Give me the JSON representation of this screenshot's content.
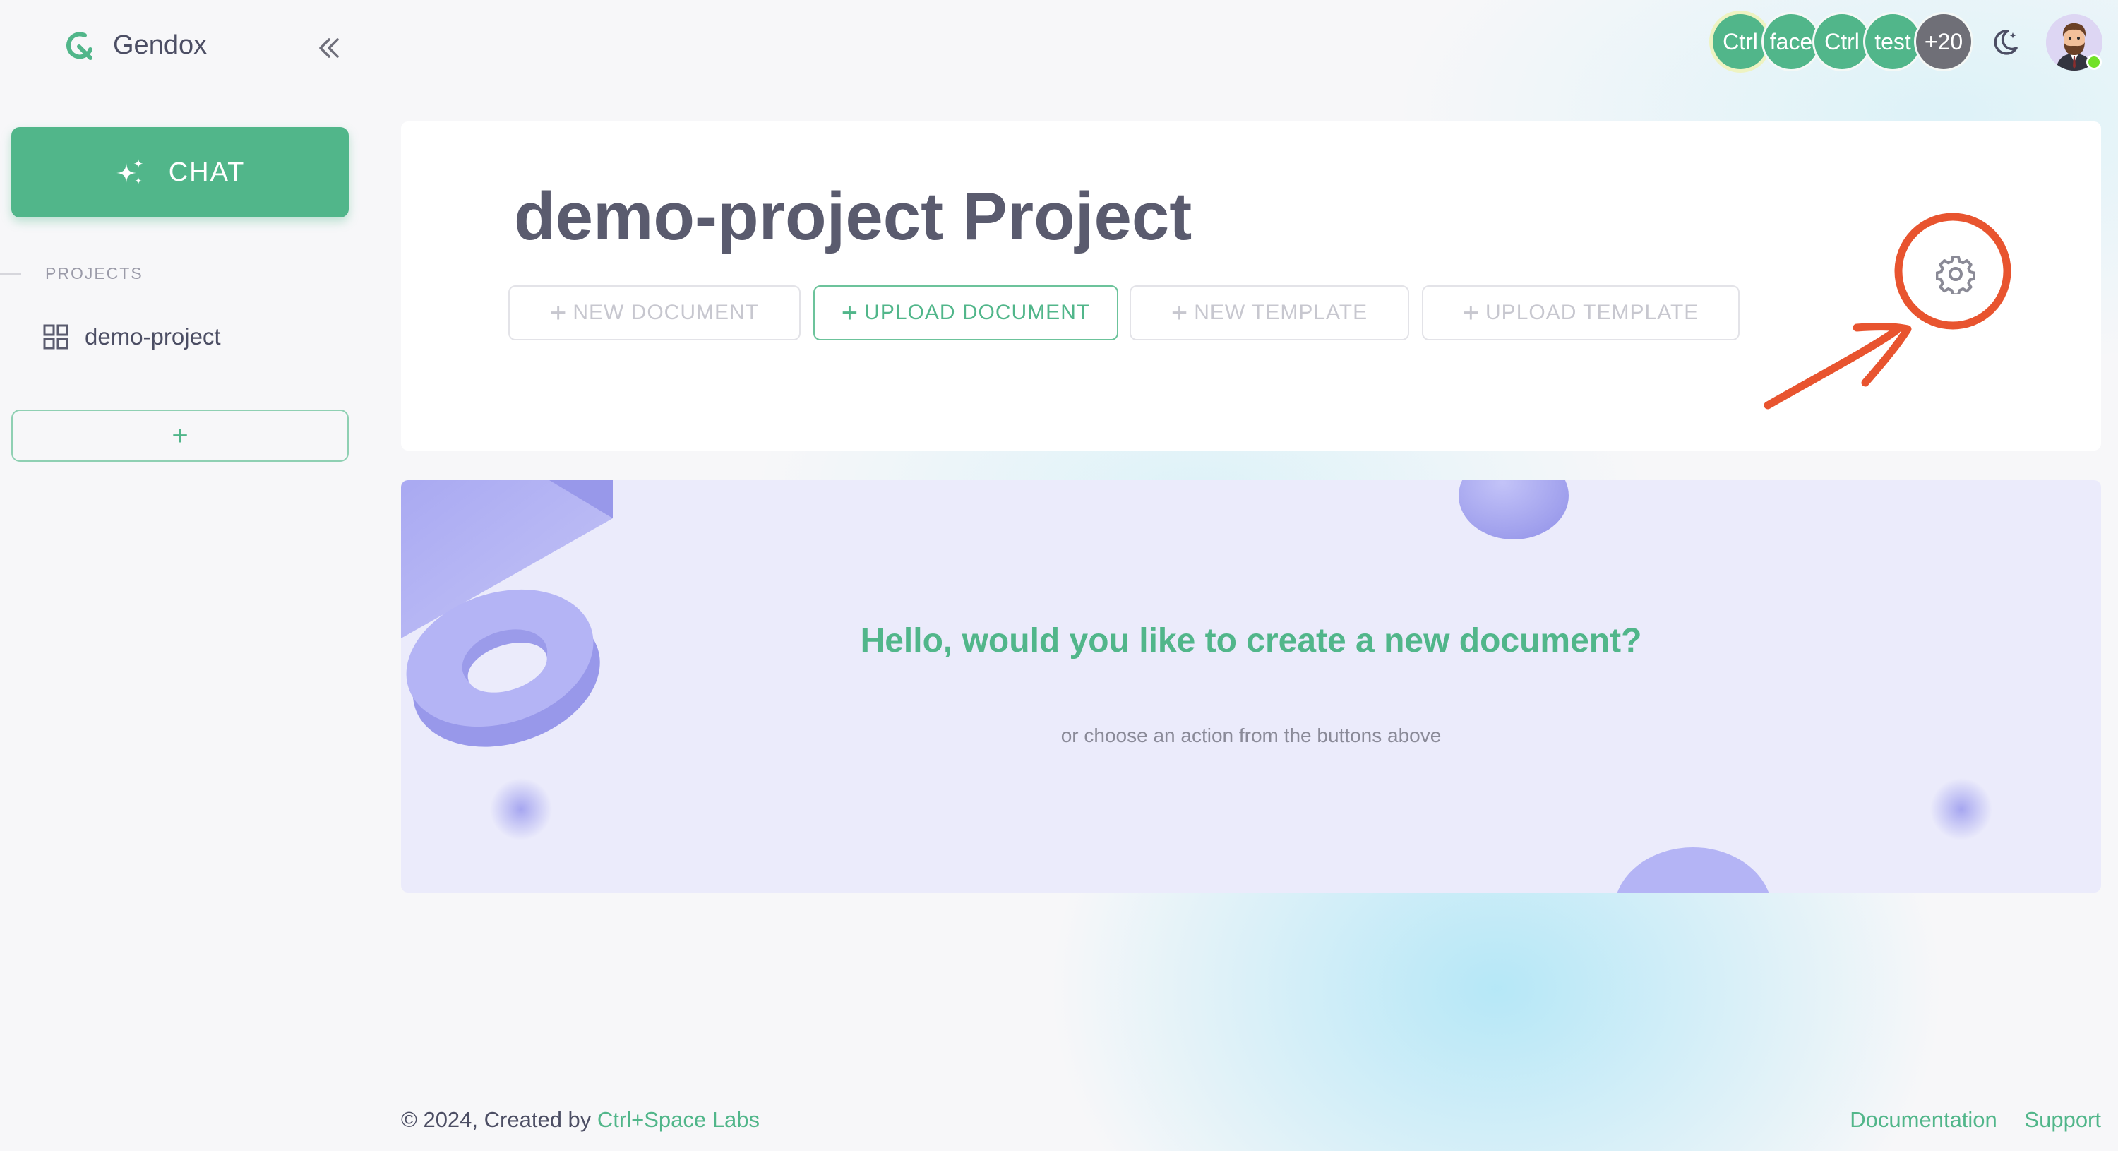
{
  "app": {
    "name": "Gendox"
  },
  "sidebar": {
    "chat_label": "CHAT",
    "projects_heading": "PROJECTS",
    "projects": [
      {
        "label": "demo-project",
        "icon": "grid-icon"
      }
    ],
    "add_project_label": "+"
  },
  "topbar": {
    "member_avatars": [
      "Ctrl",
      "face",
      "Ctrl",
      "test"
    ],
    "more_members": "+20",
    "theme_icon": "moon-icon"
  },
  "header": {
    "title": "demo-project Project",
    "actions": [
      {
        "label": "NEW DOCUMENT",
        "enabled": false
      },
      {
        "label": "UPLOAD DOCUMENT",
        "enabled": true
      },
      {
        "label": "NEW TEMPLATE",
        "enabled": false
      },
      {
        "label": "UPLOAD TEMPLATE",
        "enabled": false
      }
    ],
    "settings_icon": "gear-icon"
  },
  "empty_state": {
    "title": "Hello, would you like to create a new document?",
    "subtitle": "or choose an action from the buttons above"
  },
  "footer": {
    "copyright": "© 2024, Created by",
    "company_link": "Ctrl+Space Labs",
    "documentation_link": "Documentation",
    "support_link": "Support"
  },
  "colors": {
    "accent": "#51b68a",
    "annotation": "#e8542f",
    "panel": "#ebebfb",
    "shapes": "#a4a4f0"
  }
}
